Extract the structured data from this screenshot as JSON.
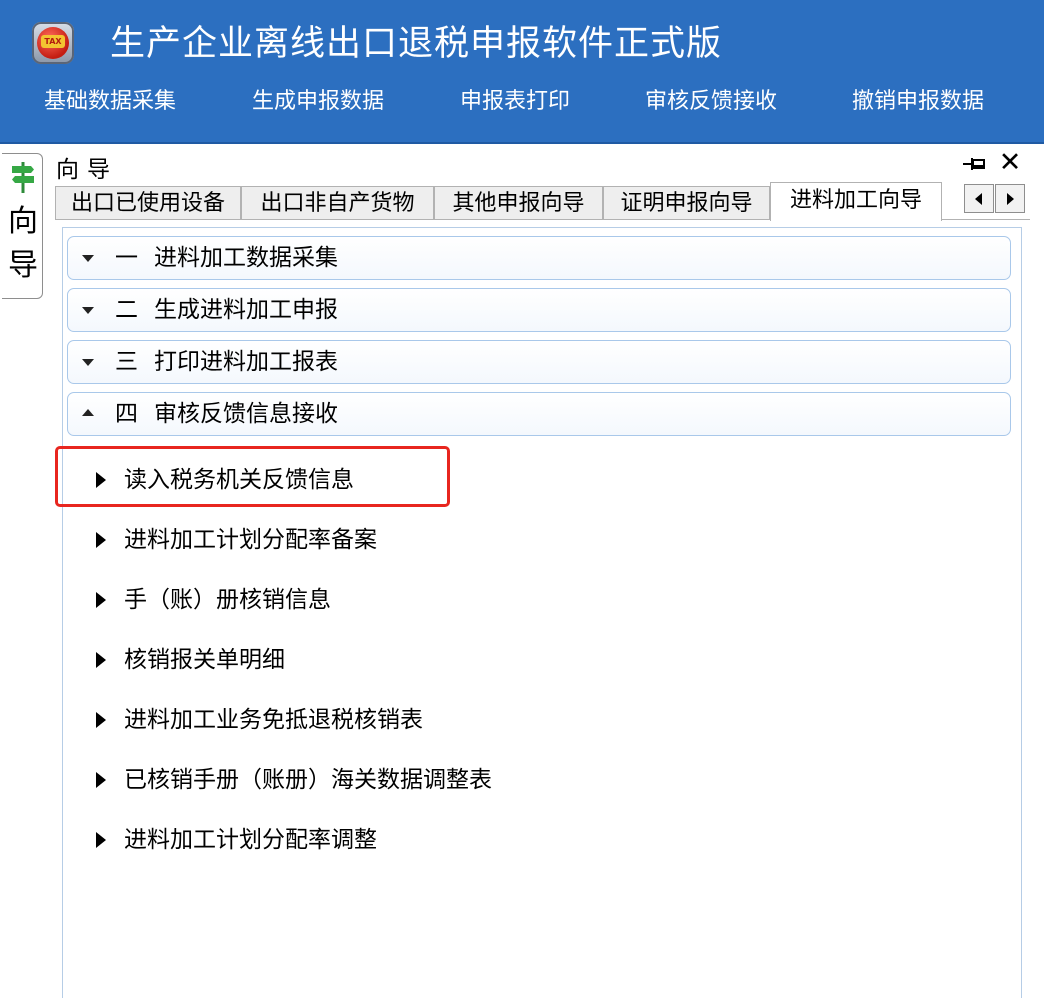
{
  "app": {
    "title": "生产企业离线出口退税申报软件正式版",
    "logo_text": "TAX"
  },
  "menu": [
    {
      "label": "基础数据采集"
    },
    {
      "label": "生成申报数据"
    },
    {
      "label": "申报表打印"
    },
    {
      "label": "审核反馈接收"
    },
    {
      "label": "撤销申报数据"
    }
  ],
  "left_tab": {
    "label": "向导"
  },
  "panel": {
    "title": "向导"
  },
  "tabs": [
    {
      "label": "出口已使用设备",
      "active": false
    },
    {
      "label": "出口非自产货物",
      "active": false
    },
    {
      "label": "其他申报向导",
      "active": false
    },
    {
      "label": "证明申报向导",
      "active": false
    },
    {
      "label": "进料加工向导",
      "active": true
    }
  ],
  "sections": [
    {
      "num": "一",
      "label": "进料加工数据采集",
      "expanded": false
    },
    {
      "num": "二",
      "label": "生成进料加工申报",
      "expanded": false
    },
    {
      "num": "三",
      "label": "打印进料加工报表",
      "expanded": false
    },
    {
      "num": "四",
      "label": "审核反馈信息接收",
      "expanded": true
    }
  ],
  "tasks": [
    {
      "label": "读入税务机关反馈信息",
      "highlighted": true
    },
    {
      "label": "进料加工计划分配率备案"
    },
    {
      "label": "手（账）册核销信息"
    },
    {
      "label": "核销报关单明细"
    },
    {
      "label": "进料加工业务免抵退税核销表"
    },
    {
      "label": "已核销手册（账册）海关数据调整表"
    },
    {
      "label": "进料加工计划分配率调整"
    }
  ],
  "colors": {
    "title_bar": "#2c6fc0",
    "section_border": "#a9c8ea",
    "highlight": "#e8261f"
  },
  "icons": [
    "app-logo-icon",
    "signpost-icon",
    "pin-icon",
    "close-icon",
    "chevron-down-icon",
    "chevron-up-icon",
    "triangle-right-icon",
    "scroll-left-icon",
    "scroll-right-icon"
  ]
}
